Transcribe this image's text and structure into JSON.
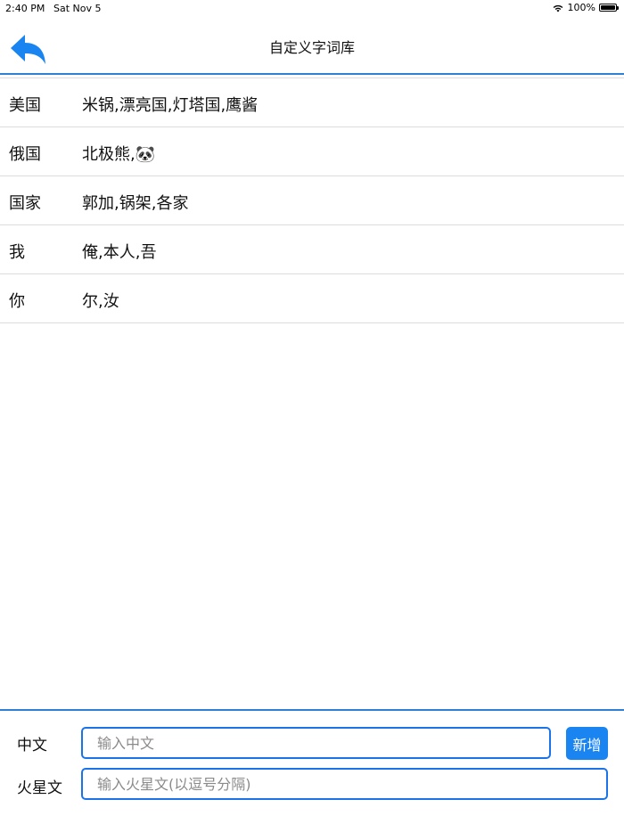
{
  "status_bar": {
    "time": "2:40 PM",
    "date": "Sat Nov 5",
    "battery": "100%",
    "wifi_icon": "wifi-icon",
    "battery_icon": "battery-icon"
  },
  "nav": {
    "title": "自定义字词库",
    "back_icon": "back-arrow-icon"
  },
  "dictionary": [
    {
      "key": "美国",
      "value": "米锅,漂亮国,灯塔国,鹰酱"
    },
    {
      "key": "俄国",
      "value": "北极熊,🐼"
    },
    {
      "key": "国家",
      "value": "郭加,锅架,各家"
    },
    {
      "key": "我",
      "value": "俺,本人,吾"
    },
    {
      "key": "你",
      "value": "尔,汝"
    }
  ],
  "form": {
    "chinese_label": "中文",
    "chinese_placeholder": "输入中文",
    "martian_label": "火星文",
    "martian_placeholder": "输入火星文(以逗号分隔)",
    "add_label": "新增"
  },
  "colors": {
    "accent": "#1a84f0",
    "divider": "#2f7fd6"
  }
}
